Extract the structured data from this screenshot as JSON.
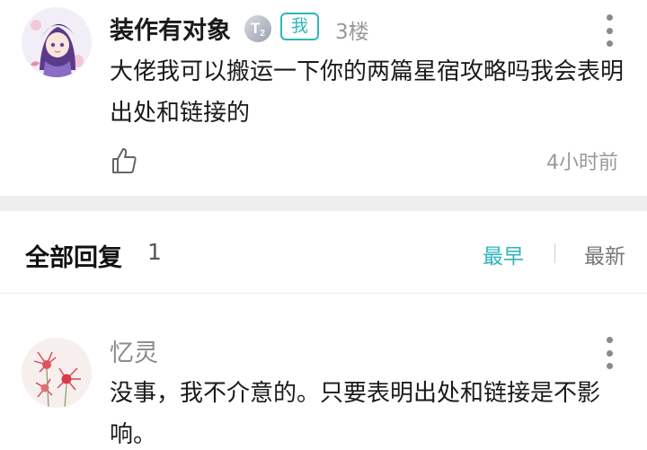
{
  "post": {
    "username": "装作有对象",
    "level_badge": "T",
    "level_sub": "2",
    "me_badge": "我",
    "floor": "3楼",
    "content": "大佬我可以搬运一下你的两篇星宿攻略吗我会表明出处和链接的",
    "time": "4小时前",
    "avatar_icon": "anime-girl-avatar",
    "like_icon": "thumbs-up-icon",
    "more_icon": "more-vertical-icon"
  },
  "replies": {
    "title": "全部回复",
    "count": "1",
    "sort_earliest": "最早",
    "sort_latest": "最新",
    "accent_color": "#2fb6b8"
  },
  "reply": {
    "username": "忆灵",
    "content": "没事，我不介意的。只要表明出处和链接是不影响。",
    "avatar_icon": "red-flower-avatar",
    "more_icon": "more-vertical-icon"
  }
}
